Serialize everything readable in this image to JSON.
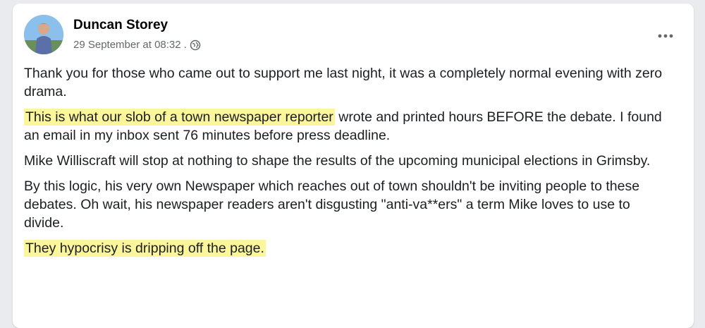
{
  "post": {
    "author": "Duncan Storey",
    "timestamp": "29 September at 08:32 .",
    "audience_icon": "globe-icon",
    "more_icon": "more-options-icon",
    "paragraphs": [
      {
        "highlight": "",
        "text": "Thank you for those who came out to support me last night, it was a completely normal evening with zero drama."
      },
      {
        "highlight": "This is what our slob of a town newspaper reporter",
        "text": " wrote and printed hours BEFORE the debate. I found an email in my inbox sent 76 minutes before press deadline."
      },
      {
        "highlight": "",
        "text": "Mike Williscraft will stop at nothing to shape the results of the upcoming municipal elections in Grimsby."
      },
      {
        "highlight": "",
        "text": "By this logic, his very own Newspaper which reaches out of town shouldn't be inviting people to these debates. Oh wait, his newspaper readers aren't disgusting \"anti-va**ers\" a term Mike loves to use to divide."
      },
      {
        "highlight": "They hypocrisy is dripping off the page.",
        "text": ""
      }
    ]
  },
  "colors": {
    "highlight": "#fbf59b",
    "meta_text": "#65676b",
    "card_bg": "#ffffff"
  }
}
